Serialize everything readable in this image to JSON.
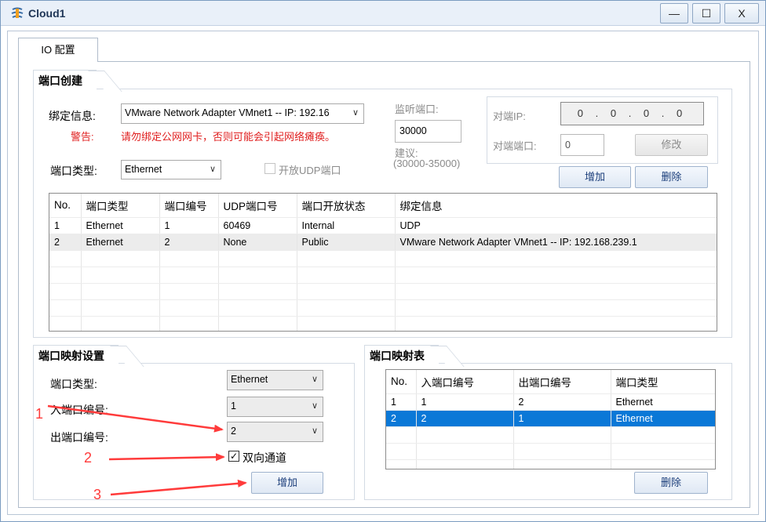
{
  "window": {
    "title": "Cloud1",
    "min": "—",
    "max": "☐",
    "close": "X"
  },
  "tabs": [
    {
      "label": "IO 配置"
    }
  ],
  "port_create": {
    "group_label": "端口创建",
    "bind_info_label": "绑定信息:",
    "bind_info_value": "VMware Network Adapter VMnet1 -- IP: 192.16",
    "warning_label": "警告:",
    "warning_text": "请勿绑定公网网卡，否则可能会引起网络瘫痪。",
    "port_type_label": "端口类型:",
    "port_type_value": "Ethernet",
    "udp_checkbox_label": "开放UDP端口",
    "listen_port_label": "监听端口:",
    "listen_port_value": "30000",
    "suggest_label": "建议:",
    "suggest_range": "(30000-35000)",
    "peer_ip_label": "对端IP:",
    "peer_ip_value": "0 . 0 . 0 . 0",
    "peer_port_label": "对端端口:",
    "peer_port_value": "0",
    "modify_button": "修改",
    "add_button": "增加",
    "delete_button": "删除",
    "table": {
      "headers": [
        "No.",
        "端口类型",
        "端口编号",
        "UDP端口号",
        "端口开放状态",
        "绑定信息"
      ],
      "rows": [
        [
          "1",
          "Ethernet",
          "1",
          "60469",
          "Internal",
          "UDP"
        ],
        [
          "2",
          "Ethernet",
          "2",
          "None",
          "Public",
          "VMware Network Adapter VMnet1 -- IP: 192.168.239.1"
        ]
      ]
    }
  },
  "port_mapping": {
    "group_label": "端口映射设置",
    "port_type_label": "端口类型:",
    "port_type_value": "Ethernet",
    "in_port_label": "入端口编号:",
    "in_port_value": "1",
    "out_port_label": "出端口编号:",
    "out_port_value": "2",
    "bidirectional_label": "双向通道",
    "bidirectional_checked": true,
    "add_button": "增加"
  },
  "mapping_table": {
    "group_label": "端口映射表",
    "headers": [
      "No.",
      "入端口编号",
      "出端口编号",
      "端口类型"
    ],
    "rows": [
      [
        "1",
        "1",
        "2",
        "Ethernet"
      ],
      [
        "2",
        "2",
        "1",
        "Ethernet"
      ]
    ],
    "delete_button": "删除"
  },
  "annotations": {
    "a1": "1",
    "a2": "2",
    "a3": "3",
    "color": "#ff3b3b"
  }
}
